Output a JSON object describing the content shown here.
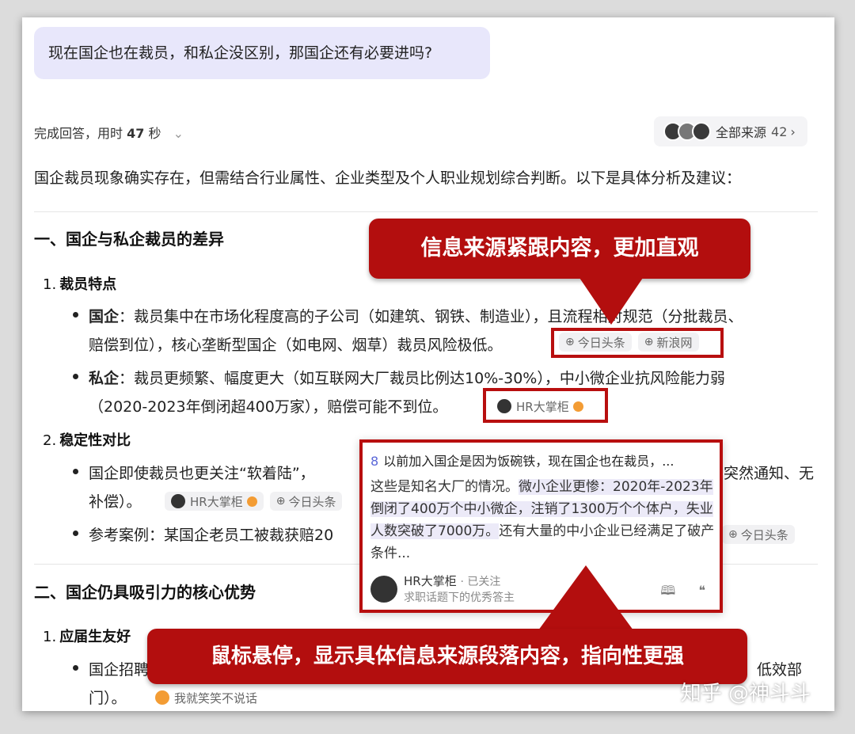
{
  "question": "现在国企也在裁员，和私企没区别，那国企还有必要进吗?",
  "status": {
    "prefix": "完成回答，用时",
    "seconds": "47",
    "suffix": "秒",
    "chev": "⌄"
  },
  "sources_button": {
    "label": "全部来源",
    "count": "42",
    "arrow": "›"
  },
  "intro": "国企裁员现象确实存在，但需结合行业属性、企业类型及个人职业规划综合判断。以下是具体分析及建议：",
  "section1": {
    "title": "一、国企与私企裁员的差异",
    "sub1": {
      "num": "1.",
      "title": "裁员特点"
    },
    "b1_label": "国企",
    "b1_line1": "：裁员集中在市场化程度高的子公司（如建筑、钢铁、制造业），且流程相对规范（分批裁员、",
    "b1_line2": "赔偿到位），核心垄断型国企（如电网、烟草）裁员风险极低。",
    "b1_chips": [
      "今日头条",
      "新浪网"
    ],
    "b2_label": "私企",
    "b2_line1": "：裁员更频繁、幅度更大（如互联网大厂裁员比例达10%-30%），中小微企业抗风险能力弱",
    "b2_line2": "（2020-2023年倒闭超400万家），赔偿可能不到位。",
    "b2_chip": "HR大掌柜",
    "sub2": {
      "num": "2.",
      "title": "稳定性对比"
    },
    "b3_line1a": "国企即使裁员也更关注“软着陆”，",
    "b3_line1b": "突然通知、无",
    "b3_line2": "补偿）。",
    "b3_chips": [
      "HR大掌柜",
      "今日头条"
    ],
    "b4_text": "参考案例：某国企老员工被裁获赔20",
    "b4_chip": "今日头条"
  },
  "section2": {
    "title": "二、国企仍具吸引力的核心优势",
    "sub1": {
      "num": "1.",
      "title": "应届生友好"
    },
    "b1_line1a": "国企招聘",
    "b1_line1b": "低效部",
    "b1_line2": "门）。",
    "b1_chip": "我就笑笑不说话"
  },
  "popup": {
    "index": "8",
    "head": "以前加入国企是因为饭碗铁，现在国企也在裁员，...",
    "body_pre": "这些是知名大厂的情况。",
    "body_hl": "微小企业更惨：2020年-2023年倒闭了400万个中小微企，注销了1300万个个体户，失业人数突破了7000万。",
    "body_post": "还有大量的中小企业已经满足了破产条件...",
    "author": "HR大掌柜",
    "follow": "· 已关注",
    "desc": "求职话题下的优秀答主",
    "icon_book": "🕮",
    "icon_quote": "❝"
  },
  "callout_top": "信息来源紧跟内容，更加直观",
  "callout_bottom": "鼠标悬停，显示具体信息来源段落内容，指向性更强",
  "watermark": "知乎 @神斗斗",
  "colors": {
    "accent_red": "#b30e0e",
    "bubble": "#e8e7fb",
    "link_index": "#5a67d8"
  }
}
